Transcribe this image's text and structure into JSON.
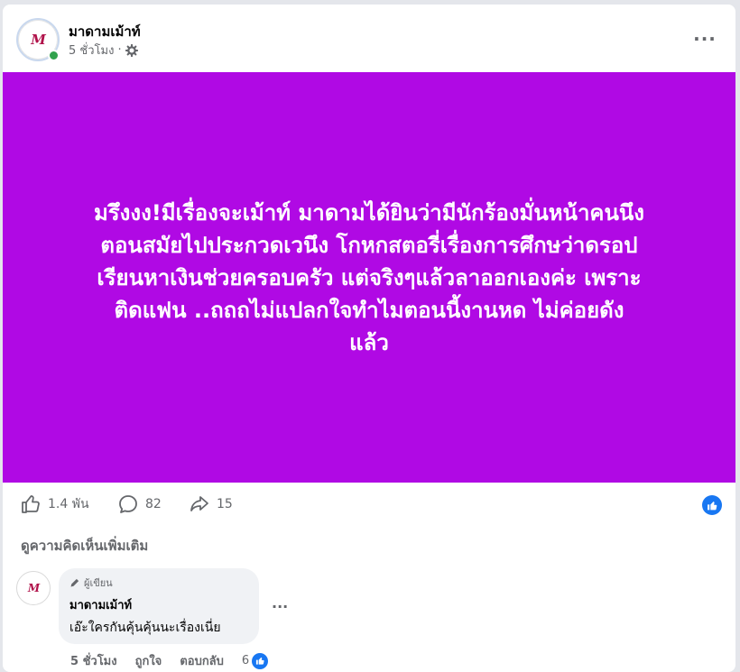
{
  "post": {
    "author": "มาดามเม้าท์",
    "time": "5 ชั่วโมง",
    "separator": "·",
    "privacy_icon": "gear-icon",
    "more_label": "···",
    "avatar_logo": "M",
    "background_color": "#b009e4",
    "lines": [
      "มรึงงง!มีเรื่องจะเม้าท์ มาดามได้ยินว่ามีนักร้องมั่นหน้าคนนึง",
      "ตอนสมัยไปประกวดเวนึง โกหกสตอรี่เรื่องการศึกษว่าดรอป",
      "เรียนหาเงินช่วยครอบครัว แต่จริงๆแล้วลาออกเองค่ะ เพราะ",
      "ติดแฟน ..ถถถไม่แปลกใจทำไมตอนนี้งานหด ไม่ค่อยดัง",
      "แล้ว"
    ]
  },
  "stats": {
    "likes": "1.4 พัน",
    "comments": "82",
    "shares": "15",
    "accent": "#1877f2"
  },
  "comments_section": {
    "more_comments_label": "ดูความคิดเห็นเพิ่มเติม",
    "comment": {
      "badge": "ผู้เขียน",
      "author": "มาดามเม้าท์",
      "text": "เอ๊ะใครกันคุ้นคุ้นนะเรื่องเนี่ย",
      "more_label": "...",
      "time": "5 ชั่วโมง",
      "like_action": "ถูกใจ",
      "reply_action": "ตอบกลับ",
      "reaction_count": "6"
    }
  }
}
